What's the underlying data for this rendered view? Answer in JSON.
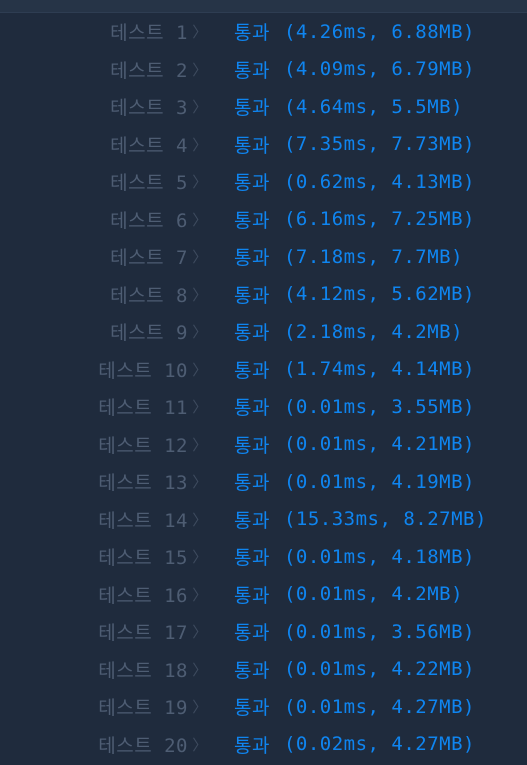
{
  "colors": {
    "background": "#1f2b3d",
    "label": "#4e5d73",
    "pass": "#0f85f0"
  },
  "icons": {
    "row_separator": "chevron-right-icon"
  },
  "results": [
    {
      "label": "테스트 1",
      "status": "통과",
      "detail": "(4.26ms, 6.88MB)"
    },
    {
      "label": "테스트 2",
      "status": "통과",
      "detail": "(4.09ms, 6.79MB)"
    },
    {
      "label": "테스트 3",
      "status": "통과",
      "detail": "(4.64ms, 5.5MB)"
    },
    {
      "label": "테스트 4",
      "status": "통과",
      "detail": "(7.35ms, 7.73MB)"
    },
    {
      "label": "테스트 5",
      "status": "통과",
      "detail": "(0.62ms, 4.13MB)"
    },
    {
      "label": "테스트 6",
      "status": "통과",
      "detail": "(6.16ms, 7.25MB)"
    },
    {
      "label": "테스트 7",
      "status": "통과",
      "detail": "(7.18ms, 7.7MB)"
    },
    {
      "label": "테스트 8",
      "status": "통과",
      "detail": "(4.12ms, 5.62MB)"
    },
    {
      "label": "테스트 9",
      "status": "통과",
      "detail": "(2.18ms, 4.2MB)"
    },
    {
      "label": "테스트 10",
      "status": "통과",
      "detail": "(1.74ms, 4.14MB)"
    },
    {
      "label": "테스트 11",
      "status": "통과",
      "detail": "(0.01ms, 3.55MB)"
    },
    {
      "label": "테스트 12",
      "status": "통과",
      "detail": "(0.01ms, 4.21MB)"
    },
    {
      "label": "테스트 13",
      "status": "통과",
      "detail": "(0.01ms, 4.19MB)"
    },
    {
      "label": "테스트 14",
      "status": "통과",
      "detail": "(15.33ms, 8.27MB)"
    },
    {
      "label": "테스트 15",
      "status": "통과",
      "detail": "(0.01ms, 4.18MB)"
    },
    {
      "label": "테스트 16",
      "status": "통과",
      "detail": "(0.01ms, 4.2MB)"
    },
    {
      "label": "테스트 17",
      "status": "통과",
      "detail": "(0.01ms, 3.56MB)"
    },
    {
      "label": "테스트 18",
      "status": "통과",
      "detail": "(0.01ms, 4.22MB)"
    },
    {
      "label": "테스트 19",
      "status": "통과",
      "detail": "(0.01ms, 4.27MB)"
    },
    {
      "label": "테스트 20",
      "status": "통과",
      "detail": "(0.02ms, 4.27MB)"
    }
  ]
}
